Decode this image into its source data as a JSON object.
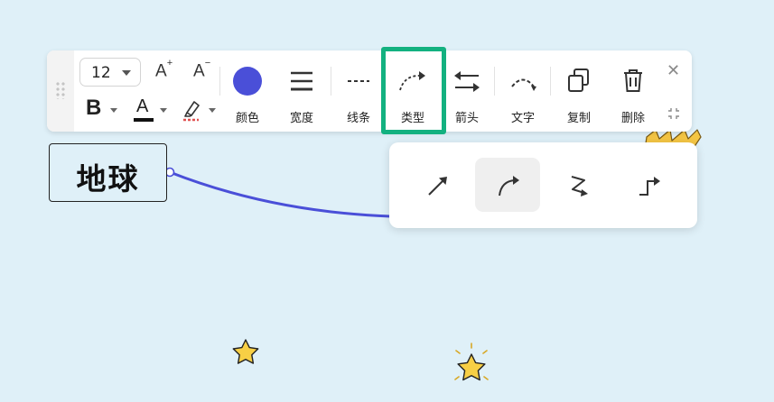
{
  "toolbar": {
    "font_size": "12",
    "increase_font_label": "A",
    "increase_font_sup": "+",
    "decrease_font_label": "A",
    "decrease_font_sup": "−",
    "bold_label": "B",
    "font_color_label": "A",
    "tools": [
      {
        "label": "颜色",
        "icon": "color-circle-icon"
      },
      {
        "label": "宽度",
        "icon": "line-width-icon"
      },
      {
        "label": "线条",
        "icon": "dashed-line-icon"
      },
      {
        "label": "类型",
        "icon": "curve-type-icon"
      },
      {
        "label": "箭头",
        "icon": "arrows-icon"
      },
      {
        "label": "文字",
        "icon": "text-on-curve-icon"
      },
      {
        "label": "复制",
        "icon": "copy-icon"
      },
      {
        "label": "删除",
        "icon": "trash-icon"
      }
    ],
    "close_symbol": "✕"
  },
  "colors": {
    "line_color": "#4a4fd8",
    "highlight_border": "#13b180",
    "canvas_bg": "#dff0f8"
  },
  "connector_type_options": [
    {
      "name": "straight",
      "icon": "straight-arrow-icon",
      "selected": false
    },
    {
      "name": "curved",
      "icon": "curved-arrow-icon",
      "selected": true
    },
    {
      "name": "zigzag",
      "icon": "zigzag-arrow-icon",
      "selected": false
    },
    {
      "name": "elbow",
      "icon": "elbow-arrow-icon",
      "selected": false
    }
  ],
  "node": {
    "text": "地球"
  }
}
